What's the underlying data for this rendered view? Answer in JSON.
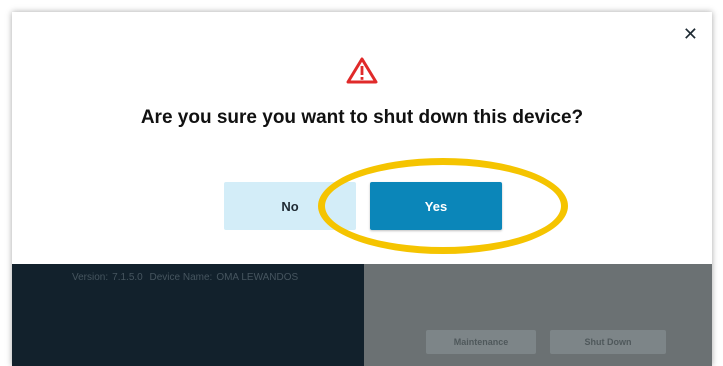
{
  "dialog": {
    "title": "Are you sure you want to shut down this device?",
    "close_icon": "close-icon",
    "warning_icon": "warning-triangle-icon",
    "no_label": "No",
    "yes_label": "Yes"
  },
  "background": {
    "version_label": "Version:",
    "version_value": "7.1.5.0",
    "device_name_label": "Device Name:",
    "device_name_value": "OMA LEWANDOS",
    "maintenance_label": "Maintenance",
    "shutdown_label": "Shut Down"
  },
  "colors": {
    "yes_button": "#0b86b9",
    "no_button": "#d3edf8",
    "warning": "#e02a2a",
    "highlight": "#f5c400"
  }
}
